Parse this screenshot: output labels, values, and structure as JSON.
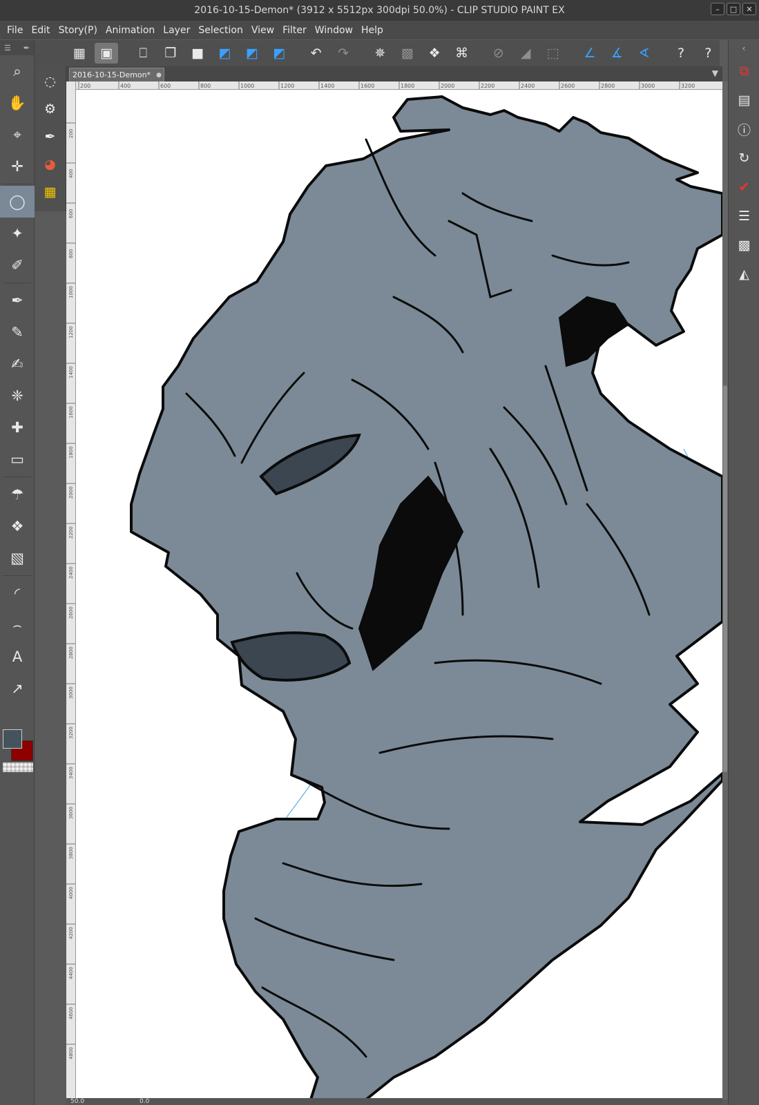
{
  "window": {
    "title": "2016-10-15-Demon* (3912 x 5512px 300dpi 50.0%)  - CLIP STUDIO PAINT EX",
    "controls": [
      "–",
      "□",
      "✕"
    ]
  },
  "menu": [
    "File",
    "Edit",
    "Story(P)",
    "Animation",
    "Layer",
    "Selection",
    "View",
    "Filter",
    "Window",
    "Help"
  ],
  "commandbar": [
    {
      "icon": "grid-icon",
      "glyph": "▦"
    },
    {
      "icon": "canvas-view-icon",
      "glyph": "▣"
    },
    {
      "icon": "new-file-icon",
      "glyph": "⎕"
    },
    {
      "icon": "open-folder-icon",
      "glyph": "❐"
    },
    {
      "icon": "save-icon",
      "glyph": "■"
    },
    {
      "icon": "select-blue-icon",
      "glyph": "◩"
    },
    {
      "icon": "select-blue-icon-2",
      "glyph": "◩"
    },
    {
      "icon": "select-blue-icon-3",
      "glyph": "◩"
    },
    {
      "icon": "undo-icon",
      "glyph": "↶"
    },
    {
      "icon": "redo-icon",
      "glyph": "↷"
    },
    {
      "icon": "transform-dots-icon",
      "glyph": "✵"
    },
    {
      "icon": "transform-box-icon",
      "glyph": "▩"
    },
    {
      "icon": "fill-bucket-icon",
      "glyph": "❖"
    },
    {
      "icon": "free-transform-icon",
      "glyph": "⌘"
    },
    {
      "icon": "clear-icon",
      "glyph": "⊘"
    },
    {
      "icon": "fill-selection-icon",
      "glyph": "◢"
    },
    {
      "icon": "select-all-icon",
      "glyph": "⬚"
    },
    {
      "icon": "ruler-snap-icon",
      "glyph": "∠"
    },
    {
      "icon": "ruler-snap-icon-2",
      "glyph": "∡"
    },
    {
      "icon": "ruler-snap-icon-3",
      "glyph": "∢"
    },
    {
      "icon": "help-icon",
      "glyph": "?"
    },
    {
      "icon": "help-icon-2",
      "glyph": "?"
    }
  ],
  "tools": [
    {
      "name": "zoom-icon",
      "glyph": "⌕"
    },
    {
      "name": "hand-icon",
      "glyph": "✋"
    },
    {
      "name": "operation-icon",
      "glyph": "⌖"
    },
    {
      "name": "move-layer-icon",
      "glyph": "✛"
    },
    {
      "name": "lasso-selection-icon",
      "glyph": "◯"
    },
    {
      "name": "auto-select-icon",
      "glyph": "✦"
    },
    {
      "name": "eyedropper-icon",
      "glyph": "✐"
    },
    {
      "name": "pen-icon",
      "glyph": "✒"
    },
    {
      "name": "pencil-icon",
      "glyph": "✎"
    },
    {
      "name": "brush-icon",
      "glyph": "✍"
    },
    {
      "name": "airbrush-icon",
      "glyph": "❈"
    },
    {
      "name": "decoration-icon",
      "glyph": "✚"
    },
    {
      "name": "eraser-icon",
      "glyph": "▭"
    },
    {
      "name": "blend-icon",
      "glyph": "☂"
    },
    {
      "name": "fill-icon",
      "glyph": "❖"
    },
    {
      "name": "gradient-icon",
      "glyph": "▧"
    },
    {
      "name": "figure-icon",
      "glyph": "◜"
    },
    {
      "name": "curve-icon",
      "glyph": "⌢"
    },
    {
      "name": "text-icon",
      "glyph": "A"
    },
    {
      "name": "correct-line-icon",
      "glyph": "↗"
    }
  ],
  "subtools": [
    {
      "name": "lasso-subtool-icon",
      "glyph": "◌"
    },
    {
      "name": "gear-icon",
      "glyph": "⚙"
    },
    {
      "name": "pen-property-icon",
      "glyph": "✒"
    },
    {
      "name": "color-wheel-icon",
      "glyph": "◕"
    },
    {
      "name": "color-set-icon",
      "glyph": "▦"
    }
  ],
  "colors": {
    "main": "#45535c",
    "sub": "#8c0000",
    "fill": "#7b8a96",
    "line": "#0b0b0b",
    "dark": "#3c4650",
    "sketch": "#5aaee8"
  },
  "document_tab": {
    "label": "2016-10-15-Demon*",
    "close": "●",
    "dropdown": "▼"
  },
  "rulers": {
    "top": [
      "200",
      "400",
      "600",
      "800",
      "1000",
      "1200",
      "1400",
      "1600",
      "1800",
      "2000",
      "2200",
      "2400",
      "2600",
      "2800",
      "3000",
      "3200"
    ],
    "left": [
      "200",
      "400",
      "600",
      "800",
      "1000",
      "1200",
      "1400",
      "1600",
      "1800",
      "2000",
      "2200",
      "2400",
      "2600",
      "2800",
      "3000",
      "3200",
      "3400",
      "3600",
      "3800",
      "4000",
      "4200",
      "4400",
      "4600",
      "4800"
    ]
  },
  "status": {
    "zoom": "50.0",
    "angle": "0.0"
  },
  "right_panel": [
    {
      "name": "layer-property-icon",
      "glyph": "⧉",
      "red": true
    },
    {
      "name": "layer-stack-icon",
      "glyph": "▤",
      "red": false
    },
    {
      "name": "info-icon",
      "glyph": "ⓘ",
      "red": false
    },
    {
      "name": "sync-icon",
      "glyph": "↻",
      "red": false
    },
    {
      "name": "check-icon",
      "glyph": "✔",
      "red": true
    },
    {
      "name": "layers-icon",
      "glyph": "☰",
      "red": false
    },
    {
      "name": "clapper-icon",
      "glyph": "▩",
      "red": false
    },
    {
      "name": "navigator-icon",
      "glyph": "◭",
      "red": false
    }
  ]
}
